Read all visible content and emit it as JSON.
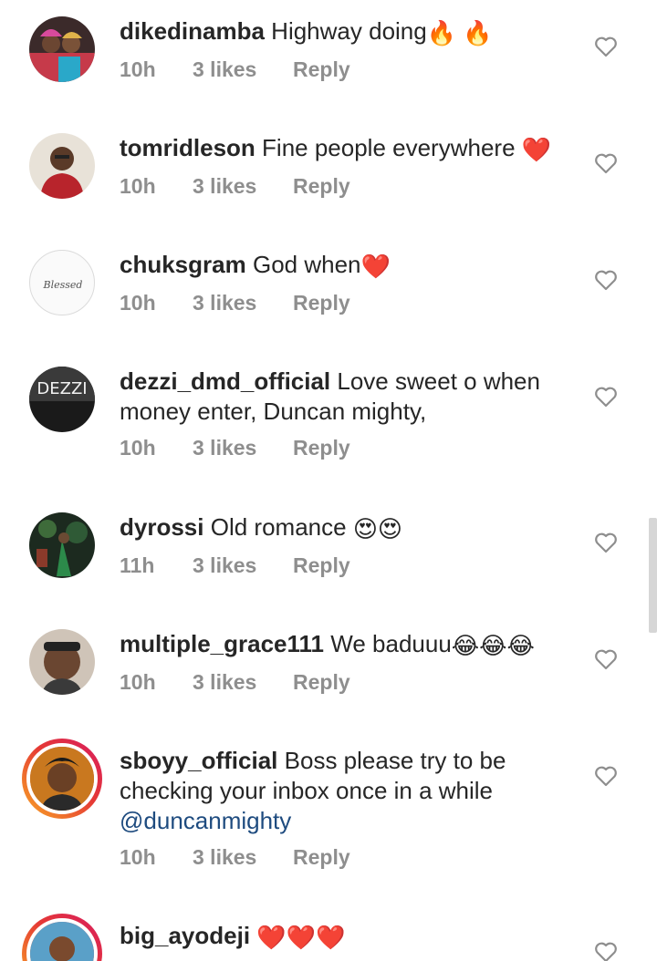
{
  "comments": [
    {
      "username": "dikedinamba",
      "text": "Highway doing",
      "emoji": "🔥 🔥",
      "time": "10h",
      "likes": "3 likes",
      "reply": "Reply"
    },
    {
      "username": "tomridleson",
      "text": "Fine people everywhere",
      "emoji": "❤️",
      "time": "10h",
      "likes": "3 likes",
      "reply": "Reply"
    },
    {
      "username": "chuksgram",
      "text": "God when",
      "emoji": "❤️",
      "time": "10h",
      "likes": "3 likes",
      "reply": "Reply",
      "avatar_text": "Blessed"
    },
    {
      "username": "dezzi_dmd_official",
      "text": "Love sweet o when money enter, Duncan mighty,",
      "emoji": "",
      "time": "10h",
      "likes": "3 likes",
      "reply": "Reply",
      "avatar_text": "DEZZI"
    },
    {
      "username": "dyrossi",
      "text": "Old romance",
      "emoji": "😍😍",
      "time": "11h",
      "likes": "3 likes",
      "reply": "Reply"
    },
    {
      "username": "multiple_grace111",
      "text": "We baduuu",
      "emoji": "😂😂😂",
      "time": "10h",
      "likes": "3 likes",
      "reply": "Reply"
    },
    {
      "username": "sboyy_official",
      "text": "Boss please try to be checking your inbox once in a while",
      "mention": "@duncanmighty",
      "emoji": "",
      "time": "10h",
      "likes": "3 likes",
      "reply": "Reply"
    },
    {
      "username": "big_ayodeji",
      "text": "",
      "emoji": "❤️❤️❤️",
      "time": "",
      "likes": "",
      "reply": ""
    }
  ],
  "icons": {
    "like": "heart-outline-icon"
  },
  "colors": {
    "text": "#262626",
    "meta": "#8e8e8e",
    "mention": "#1e4b7f",
    "heart_red": "#e0245e"
  }
}
